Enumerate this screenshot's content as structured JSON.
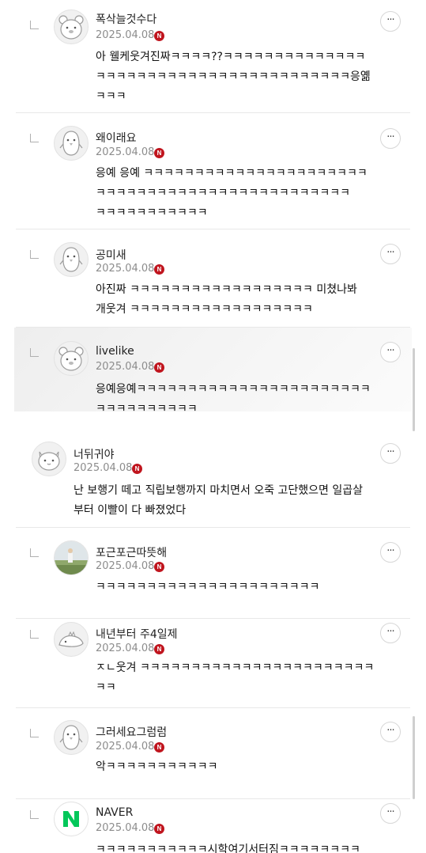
{
  "more_glyph": "···",
  "badge_glyph": "N",
  "comments": [
    {
      "nickname": "폭삭늘것수다",
      "date": "2025.04.08",
      "text": "아 웰케웃겨진짜ㅋㅋㅋㅋ??ㅋㅋㅋㅋㅋㅋㅋㅋㅋㅋㅋㅋㅋㅋ\nㅋㅋㅋㅋㅋㅋㅋㅋㅋㅋㅋㅋㅋㅋㅋㅋㅋㅋㅋㅋㅋㅋㅋㅋㅋ응옒\nㅋㅋㅋ",
      "avatar": "bear-icon"
    },
    {
      "nickname": "왜이래요",
      "date": "2025.04.08",
      "text": "응예 응예 ㅋㅋㅋㅋㅋㅋㅋㅋㅋㅋㅋㅋㅋㅋㅋㅋㅋㅋㅋㅋㅋㅋ\nㅋㅋㅋㅋㅋㅋㅋㅋㅋㅋㅋㅋㅋㅋㅋㅋㅋㅋㅋㅋㅋㅋㅋㅋㅋ\nㅋㅋㅋㅋㅋㅋㅋㅋㅋㅋㅋ",
      "avatar": "penguin-icon"
    },
    {
      "nickname": "공미새",
      "date": "2025.04.08",
      "text": "아진짜 ㅋㅋㅋㅋㅋㅋㅋㅋㅋㅋㅋㅋㅋㅋㅋㅋㅋㅋ 미쳤나봐\n개웃겨 ㅋㅋㅋㅋㅋㅋㅋㅋㅋㅋㅋㅋㅋㅋㅋㅋㅋㅋ",
      "avatar": "penguin-icon"
    },
    {
      "nickname": "livelike",
      "date": "2025.04.08",
      "text": "응예응예ㅋㅋㅋㅋㅋㅋㅋㅋㅋㅋㅋㅋㅋㅋㅋㅋㅋㅋㅋㅋㅋㅋㅋ\nㅋㅋㅋㅋㅋㅋㅋㅋㅋㅋ",
      "avatar": "bear-icon"
    },
    {
      "nickname": "너뒤귀야",
      "date": "2025.04.08",
      "text": "난 보행기 떼고 직립보행까지 마치면서 오죽 고단했으면 일곱살\n부터 이빨이 다 빠졌었다",
      "avatar": "cat-icon"
    },
    {
      "nickname": "포근포근따뜻해",
      "date": "2025.04.08",
      "text": "ㅋㅋㅋㅋㅋㅋㅋㅋㅋㅋㅋㅋㅋㅋㅋㅋㅋㅋㅋㅋㅋㅋ",
      "avatar": "photo-avatar"
    },
    {
      "nickname": "내년부터 주4일제",
      "date": "2025.04.08",
      "text": "ㅈㄴ웃겨 ㅋㅋㅋㅋㅋㅋㅋㅋㅋㅋㅋㅋㅋㅋㅋㅋㅋㅋㅋㅋㅋㅋㅋ\nㅋㅋ",
      "avatar": "dino-icon"
    },
    {
      "nickname": "그러세요그럼럼",
      "date": "2025.04.08",
      "text": "악ㅋㅋㅋㅋㅋㅋㅋㅋㅋㅋㅋ",
      "avatar": "penguin-icon"
    },
    {
      "nickname": "NAVER",
      "date": "2025.04.08",
      "text": "ㅋㅋㅋㅋㅋㅋㅋㅋㅋㅋㅋ시학여기서터짐ㅋㅋㅋㅋㅋㅋㅋㅋ",
      "avatar": "naver-logo-icon"
    }
  ]
}
